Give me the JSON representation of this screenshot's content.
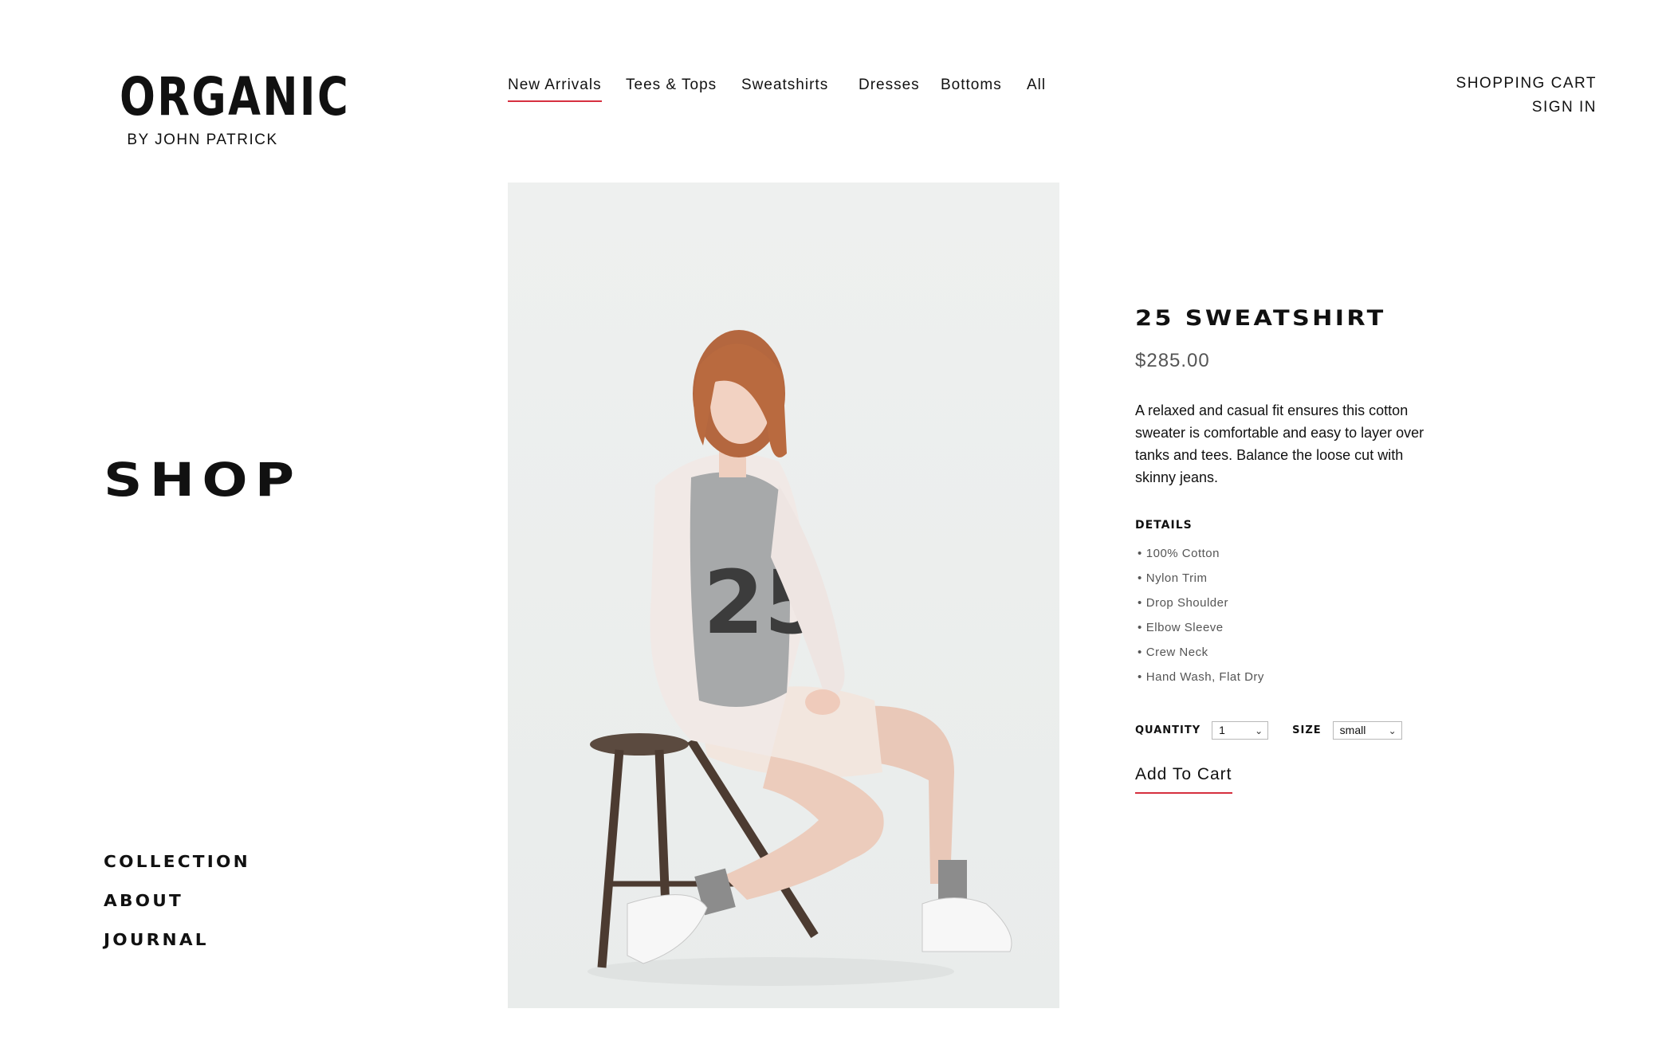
{
  "brand": {
    "name": "ORGANIC",
    "tagline": "BY JOHN PATRICK"
  },
  "topnav": {
    "items": [
      {
        "label": "New Arrivals",
        "active": true
      },
      {
        "label": "Tees & Tops"
      },
      {
        "label": "Sweatshirts"
      },
      {
        "label": "Dresses"
      },
      {
        "label": "Bottoms"
      },
      {
        "label": "All"
      }
    ]
  },
  "account": {
    "cart": "SHOPPING CART",
    "signin": "SIGN IN"
  },
  "page": {
    "title": "SHOP"
  },
  "sidenav": {
    "items": [
      "COLLECTION",
      "ABOUT",
      "JOURNAL"
    ]
  },
  "product": {
    "name": "25 SWEATSHIRT",
    "price": "$285.00",
    "description": "A relaxed and casual fit ensures this cotton sweater is comfortable and easy to layer over tanks and tees. Balance the loose cut with skinny jeans.",
    "details_heading": "DETAILS",
    "details": [
      "100% Cotton",
      "Nylon Trim",
      "Drop Shoulder",
      "Elbow Sleeve",
      "Crew Neck",
      "Hand Wash, Flat Dry"
    ],
    "quantity_label": "QUANTITY",
    "quantity_value": "1",
    "size_label": "SIZE",
    "size_value": "small",
    "cta": "Add To Cart",
    "image_graphic": "25"
  },
  "colors": {
    "accent": "#d6303f",
    "text": "#111111",
    "muted": "#555555",
    "photo_bg": "#eef0ef"
  },
  "icons": {
    "select_caret": "chevron-down-icon"
  }
}
